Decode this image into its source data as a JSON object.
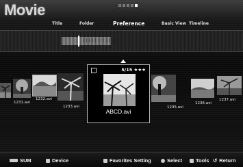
{
  "header": {
    "title": "Movie",
    "page_indicator": {
      "total": 5,
      "current": 5
    }
  },
  "tabs": [
    {
      "label": "Title",
      "active": false
    },
    {
      "label": "Folder",
      "active": false
    },
    {
      "label": "Preference",
      "active": true
    },
    {
      "label": "Basic View",
      "active": false
    },
    {
      "label": "Timeline",
      "active": false
    }
  ],
  "sort_bar": {
    "label": "❘❘❘❘❘❘❘❘❘❘❘❘❘❘"
  },
  "thumbnails": [
    {
      "label": "",
      "icon": "palm-tree-thumbnail"
    },
    {
      "label": "1231.avi",
      "icon": "tree-thumbnail"
    },
    {
      "label": "1232.avi",
      "icon": "beach-thumbnail"
    },
    {
      "label": "1233.avi",
      "icon": "palm-tree-thumbnail"
    },
    {
      "label": "1235.avi",
      "icon": "tree-thumbnail"
    },
    {
      "label": "1236.avi",
      "icon": "beach-thumbnail"
    },
    {
      "label": "1237.avi",
      "icon": "palm-tree-thumbnail"
    }
  ],
  "focused": {
    "name": "ABCD.avi",
    "rating": "5/15 ★★★",
    "icon": "palm-beach-thumbnail"
  },
  "footer": {
    "sum": "SUM",
    "device": "Device",
    "favorites": "Favorites Setting",
    "select": "Select",
    "tools": "Tools",
    "return": "Return"
  }
}
